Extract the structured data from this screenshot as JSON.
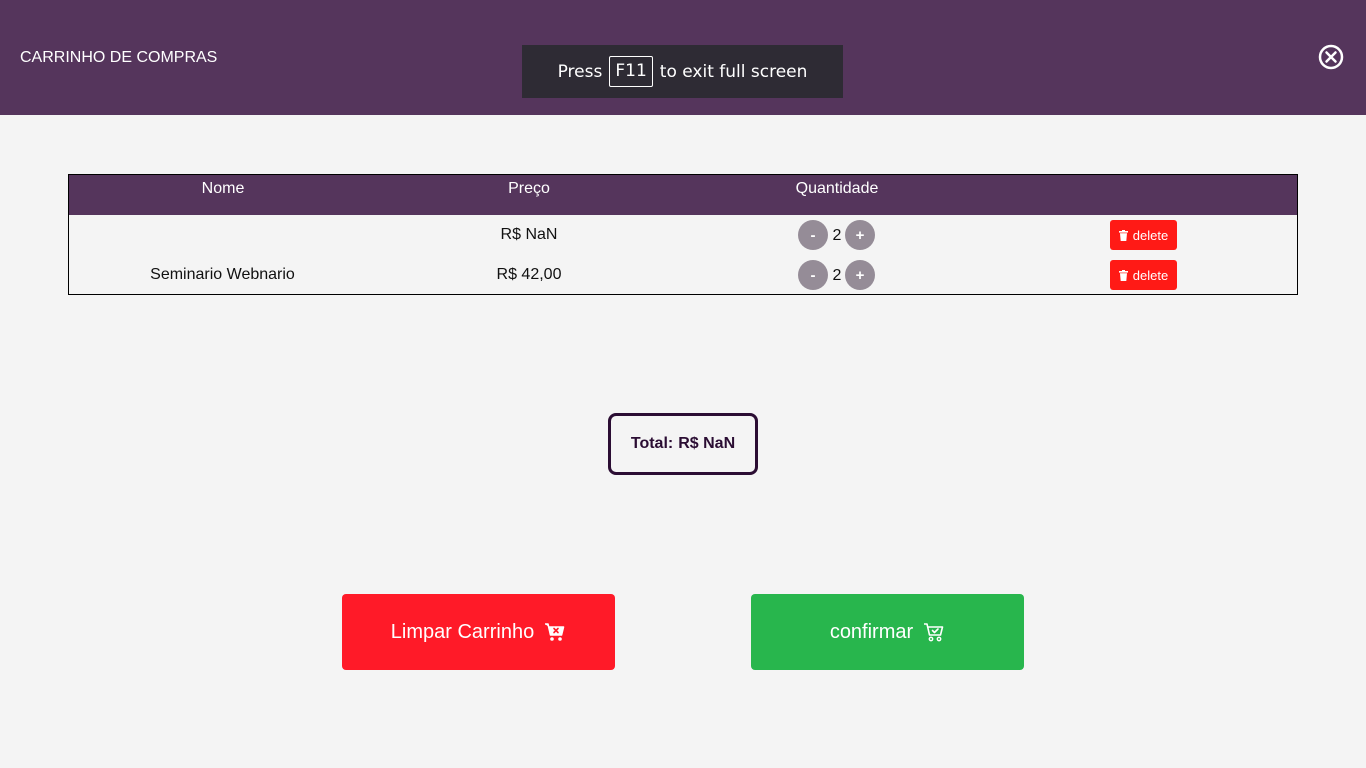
{
  "header": {
    "title": "CARRINHO DE COMPRAS",
    "close_icon": "close-circle-icon"
  },
  "fullscreen_notice": {
    "prefix": "Press",
    "key": "F11",
    "suffix": "to exit full screen"
  },
  "table": {
    "columns": [
      "Nome",
      "Preço",
      "Quantidade",
      ""
    ],
    "rows": [
      {
        "name": "",
        "price": "R$ NaN",
        "quantity": "2",
        "minus": "-",
        "plus": "+",
        "delete_label": "delete"
      },
      {
        "name": "Seminario Webnario",
        "price": "R$ 42,00",
        "quantity": "2",
        "minus": "-",
        "plus": "+",
        "delete_label": "delete"
      }
    ]
  },
  "total": {
    "label": "Total:",
    "value": "R$ NaN"
  },
  "actions": {
    "clear_label": "Limpar Carrinho",
    "clear_icon": "cart-remove-icon",
    "confirm_label": "confirmar",
    "confirm_icon": "cart-check-icon"
  },
  "colors": {
    "header_bg": "#55355c",
    "danger": "#ff1a28",
    "success": "#28b64d",
    "qty_button": "#958c97",
    "total_border": "#2b0d33"
  }
}
